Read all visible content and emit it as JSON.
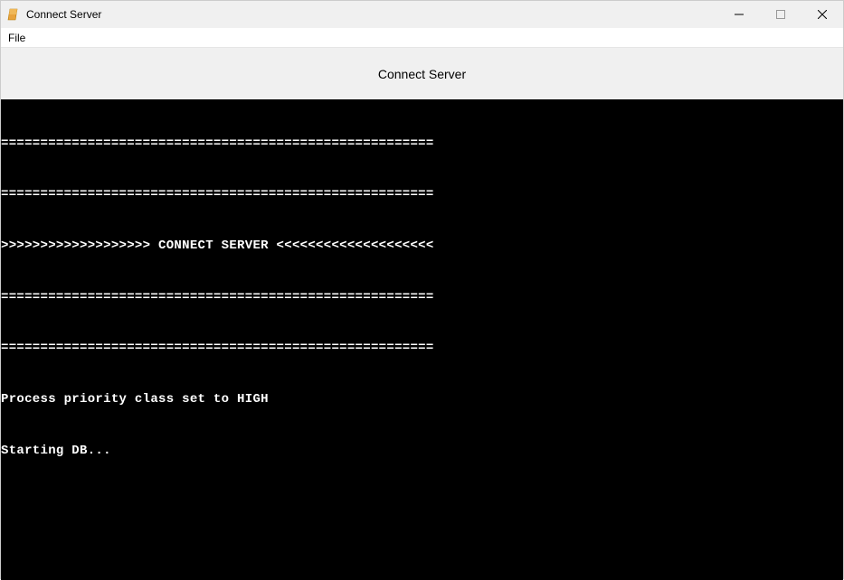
{
  "window": {
    "title": "Connect Server"
  },
  "menubar": {
    "file": "File"
  },
  "header": {
    "label": "Connect Server"
  },
  "console": {
    "lines": [
      "=======================================================",
      "=======================================================",
      ">>>>>>>>>>>>>>>>>>> CONNECT SERVER <<<<<<<<<<<<<<<<<<<<",
      "=======================================================",
      "=======================================================",
      "Process priority class set to HIGH",
      "Starting DB..."
    ]
  }
}
